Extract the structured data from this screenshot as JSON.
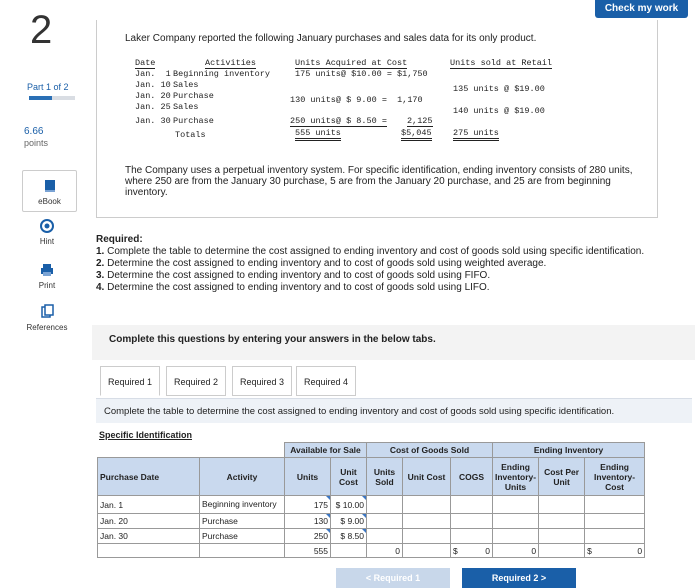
{
  "question_number": "2",
  "part_text": "Part 1 of 2",
  "part_progress": 0.5,
  "points_value": "6.66",
  "points_label": "points",
  "tools": {
    "ebook": "eBook",
    "hint": "Hint",
    "print": "Print",
    "references": "References"
  },
  "check_button": "Check my work",
  "intro": "Laker Company reported the following January purchases and sales data for its only product.",
  "purchase_table": {
    "headers": {
      "date": "Date",
      "activities": "Activities",
      "acquired": "Units Acquired at Cost",
      "sold": "Units sold at Retail"
    },
    "rows": [
      {
        "date": "Jan.  1",
        "activity": "Beginning inventory",
        "acquired": "175 units@ $10.00 = $1,750",
        "sold": ""
      },
      {
        "date": "Jan. 10",
        "activity": "Sales",
        "acquired": "",
        "sold": "135 units @ $19.00"
      },
      {
        "date": "Jan. 20",
        "activity": "Purchase",
        "acquired": "130 units@ $ 9.00 =  1,170",
        "sold": ""
      },
      {
        "date": "Jan. 25",
        "activity": "Sales",
        "acquired": "",
        "sold": "140 units @ $19.00"
      },
      {
        "date": "Jan. 30",
        "activity": "Purchase",
        "acquired_units": "250 units@ $ 8.50 =",
        "acquired_cost": "2,125",
        "sold": ""
      }
    ],
    "totals": {
      "label": "Totals",
      "units": "555 units",
      "cost": "$5,045",
      "sold": "275 units"
    }
  },
  "perpetual_text": "The Company uses a perpetual inventory system. For specific identification, ending inventory consists of 280 units, where 250 are from the January 30 purchase, 5 are from the January 20 purchase, and 25 are from beginning inventory.",
  "required": {
    "title": "Required:",
    "items": [
      {
        "num": "1.",
        "text": "Complete the table to determine the cost assigned to ending inventory and cost of goods sold using specific identification."
      },
      {
        "num": "2.",
        "text": "Determine the cost assigned to ending inventory and to cost of goods sold using weighted average."
      },
      {
        "num": "3.",
        "text": "Determine the cost assigned to ending inventory and to cost of goods sold using FIFO."
      },
      {
        "num": "4.",
        "text": "Determine the cost assigned to ending inventory and to cost of goods sold using LIFO."
      }
    ]
  },
  "band_text": "Complete this questions by entering your answers in the below tabs.",
  "tabs": [
    "Required 1",
    "Required 2",
    "Required 3",
    "Required 4"
  ],
  "tab_instruction": "Complete the table to determine the cost assigned to ending inventory and cost of goods sold using specific identification.",
  "grid": {
    "title": "Specific Identification",
    "group_headers": {
      "available": "Available for Sale",
      "cogs": "Cost of Goods Sold",
      "ending": "Ending Inventory"
    },
    "col_headers": {
      "date": "Purchase Date",
      "activity": "Activity",
      "units": "Units",
      "unit_cost": "Unit Cost",
      "units_sold": "Units Sold",
      "sold_unit_cost": "Unit Cost",
      "cogs": "COGS",
      "ending_units": "Ending Inventory- Units",
      "cost_per_unit": "Cost Per Unit",
      "ending_cost": "Ending Inventory- Cost"
    },
    "rows": [
      {
        "date": "Jan. 1",
        "activity": "Beginning inventory",
        "units": "175",
        "unit_cost": "$ 10.00"
      },
      {
        "date": "Jan. 20",
        "activity": "Purchase",
        "units": "130",
        "unit_cost": "$   9.00"
      },
      {
        "date": "Jan. 30",
        "activity": "Purchase",
        "units": "250",
        "unit_cost": "$   8.50"
      }
    ],
    "totals": {
      "units": "555",
      "units_sold": "0",
      "cogs_sym": "$",
      "cogs": "0",
      "ending_units": "0",
      "ending_sym": "$",
      "ending_cost": "0"
    }
  },
  "nav": {
    "prev": "<  Required 1",
    "next": "Required 2  >"
  }
}
